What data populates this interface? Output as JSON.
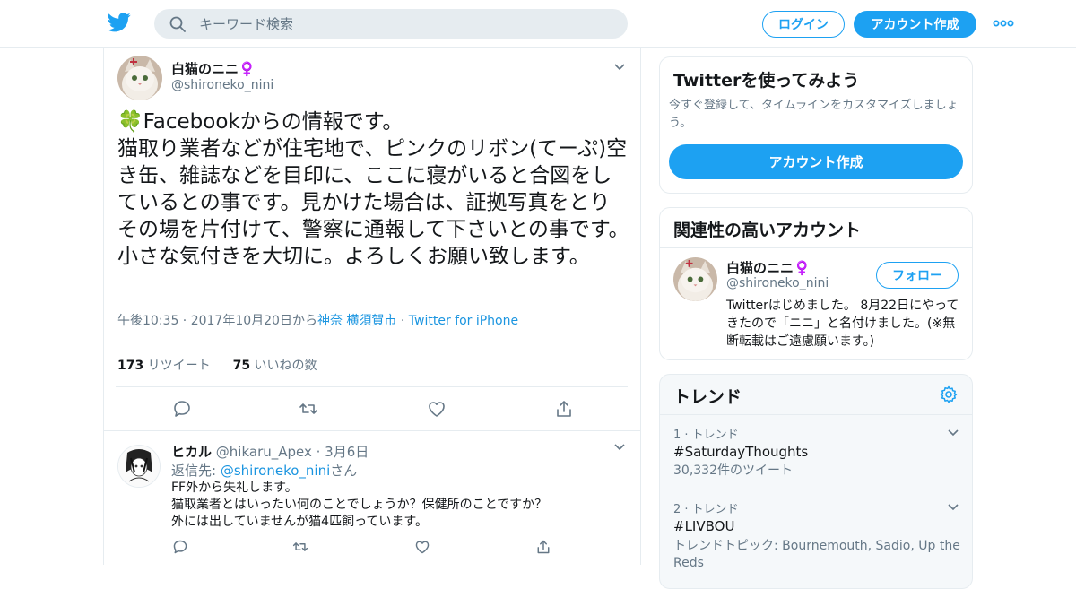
{
  "colors": {
    "accent": "#1da1f2",
    "link": "#1b95e0",
    "text": "#14171a",
    "muted": "#657786",
    "border": "#e6ecf0"
  },
  "header": {
    "logo_icon": "twitter-bird-icon",
    "search_placeholder": "キーワード検索",
    "login_label": "ログイン",
    "signup_label": "アカウント作成",
    "more_icon": "more-dots-icon"
  },
  "tweet": {
    "name": "白猫のニニ♀️",
    "handle": "@shironeko_nini",
    "text": "🍀Facebookからの情報です。\n猫取り業者などが住宅地で、ピンクのリボン(てーぷ)空き缶、雑誌などを目印に、ここに寝がいると合図をしているとの事です。見かけた場合は、証拠写真をとりその場を片付けて、警察に通報して下さいとの事です。小さな気付きを大切に。よろしくお願い致します。",
    "meta_time": "午後10:35 · 2017年10月20日から",
    "meta_location": "神奈 横須賀市",
    "meta_sep": " · ",
    "meta_source": "Twitter for iPhone",
    "retweet_count": "173",
    "retweet_label": " リツイート",
    "like_count": "75",
    "like_label": " いいねの数"
  },
  "reply": {
    "name": "ヒカル",
    "handle": " @hikaru_Apex",
    "date": " · 3月6日",
    "reply_prefix": "返信先: ",
    "reply_to": "@shironeko_nini",
    "reply_suffix": "さん",
    "text": "FF外から失礼します。\n猫取業者とはいったい何のことでしょうか？保健所のことですか？\n外には出していませんが猫4匹飼っています。"
  },
  "sidebar": {
    "wtf": {
      "title": "Twitterを使ってみよう",
      "desc": "今すぐ登録して、タイムラインをカスタマイズしましょう。",
      "button": "アカウント作成"
    },
    "related": {
      "title": "関連性の高いアカウント",
      "name": "白猫のニニ♀️",
      "handle": "@shironeko_nini",
      "follow_label": "フォロー",
      "bio": "Twitterはじめました。 8月22日にやってきたので「ニニ」と名付けました。(※無断転載はご遠慮願います。)"
    },
    "trends": {
      "title": "トレンド",
      "items": [
        {
          "meta": "1 · トレンド",
          "name": "#SaturdayThoughts",
          "count": "30,332件のツイート"
        },
        {
          "meta": "2 · トレンド",
          "name": "#LIVBOU",
          "count": "トレンドトピック: Bournemouth, Sadio, Up the Reds"
        }
      ]
    }
  }
}
